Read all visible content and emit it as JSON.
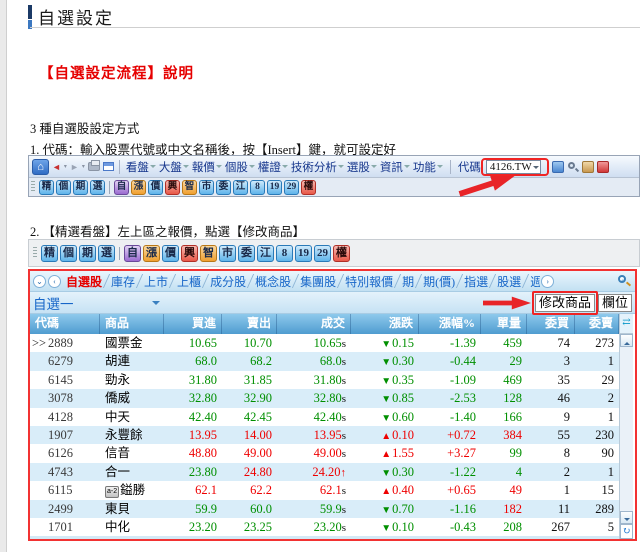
{
  "doc": {
    "title": "自選設定",
    "heading": "【自選設定流程】說明",
    "methods_line": "3 種自選股設定方式",
    "step1": "1. 代碼：輸入股票代號或中文名稱後，按【Insert】鍵，就可設定好",
    "step2": "2. 【精選看盤】左上區之報價，點選【修改商品】"
  },
  "browser_toolbar": {
    "menus": [
      "看盤",
      "大盤",
      "報價",
      "個股",
      "權證",
      "技術分析",
      "選股",
      "資訊",
      "功能"
    ],
    "code_label": "代碼",
    "code_value": "4126.TW"
  },
  "icon_strip": {
    "buttons": [
      {
        "label": "精",
        "color": "blue"
      },
      {
        "label": "個",
        "color": "blue"
      },
      {
        "label": "期",
        "color": "blue"
      },
      {
        "label": "選",
        "color": "blue"
      },
      {
        "label": "自",
        "color": "purple"
      },
      {
        "label": "漲",
        "color": "orange"
      },
      {
        "label": "價",
        "color": "blue"
      },
      {
        "label": "興",
        "color": "red"
      },
      {
        "label": "智",
        "color": "orange"
      },
      {
        "label": "市",
        "color": "blue"
      },
      {
        "label": "委",
        "color": "blue"
      },
      {
        "label": "江",
        "color": "blue"
      },
      {
        "label": "8",
        "color": "blue"
      },
      {
        "label": "19",
        "color": "blue"
      },
      {
        "label": "29",
        "color": "blue"
      },
      {
        "label": "權",
        "color": "red"
      }
    ],
    "divider_after_index": 3
  },
  "quote_panel": {
    "tabs": [
      {
        "label": "自選股",
        "active": true
      },
      {
        "label": "庫存"
      },
      {
        "label": "上市"
      },
      {
        "label": "上櫃"
      },
      {
        "label": "成分股"
      },
      {
        "label": "概念股"
      },
      {
        "label": "集團股"
      },
      {
        "label": "特別報價"
      },
      {
        "label": "期"
      },
      {
        "label": "期(價)"
      },
      {
        "label": "指選"
      },
      {
        "label": "股選"
      },
      {
        "label": "週",
        "clipped": true
      }
    ],
    "watchlist_name": "自選一",
    "modify_button_label": "修改商品",
    "columns_button_label": "欄位",
    "table": {
      "columns": [
        "代碼",
        "商品",
        "買進",
        "賣出",
        "成交",
        "漲跌",
        "漲幅%",
        "單量",
        "委買",
        "委賣"
      ],
      "rows": [
        {
          "prefix": ">>",
          "code": "2889",
          "name": "國票金",
          "buy": "10.65",
          "sell": "10.70",
          "last": "10.65",
          "sfx": "s",
          "sfx_c": "k",
          "dir": "down",
          "chg": "0.15",
          "pct": "-1.39",
          "vol": "459",
          "vol_c": "g",
          "bid": "74",
          "ask": "273",
          "pc": "ggg"
        },
        {
          "prefix": "",
          "code": "6279",
          "name": "胡連",
          "buy": "68.0",
          "sell": "68.2",
          "last": "68.0",
          "sfx": "s",
          "sfx_c": "k",
          "dir": "down",
          "chg": "0.30",
          "pct": "-0.44",
          "vol": "29",
          "vol_c": "g",
          "bid": "3",
          "ask": "1",
          "pc": "ggg"
        },
        {
          "prefix": "",
          "code": "6145",
          "name": "勁永",
          "buy": "31.80",
          "sell": "31.85",
          "last": "31.80",
          "sfx": "s",
          "sfx_c": "k",
          "dir": "down",
          "chg": "0.35",
          "pct": "-1.09",
          "vol": "469",
          "vol_c": "g",
          "bid": "35",
          "ask": "29",
          "pc": "ggg"
        },
        {
          "prefix": "",
          "code": "3078",
          "name": "僑威",
          "buy": "32.80",
          "sell": "32.90",
          "last": "32.80",
          "sfx": "s",
          "sfx_c": "k",
          "dir": "down",
          "chg": "0.85",
          "pct": "-2.53",
          "vol": "128",
          "vol_c": "g",
          "bid": "46",
          "ask": "2",
          "pc": "ggg"
        },
        {
          "prefix": "",
          "code": "4128",
          "name": "中天",
          "buy": "42.40",
          "sell": "42.45",
          "last": "42.40",
          "sfx": "s",
          "sfx_c": "k",
          "dir": "down",
          "chg": "0.60",
          "pct": "-1.40",
          "vol": "166",
          "vol_c": "g",
          "bid": "9",
          "ask": "1",
          "pc": "ggg"
        },
        {
          "prefix": "",
          "code": "1907",
          "name": "永豐餘",
          "buy": "13.95",
          "sell": "14.00",
          "last": "13.95",
          "sfx": "s",
          "sfx_c": "k",
          "dir": "up",
          "chg": "0.10",
          "pct": "+0.72",
          "vol": "384",
          "vol_c": "r",
          "bid": "55",
          "ask": "230",
          "pc": "rrr"
        },
        {
          "prefix": "",
          "code": "6126",
          "name": "信音",
          "buy": "48.80",
          "sell": "49.00",
          "last": "49.00",
          "sfx": "s",
          "sfx_c": "k",
          "dir": "up",
          "chg": "1.55",
          "pct": "+3.27",
          "vol": "99",
          "vol_c": "g",
          "bid": "8",
          "ask": "90",
          "pc": "rrr"
        },
        {
          "prefix": "",
          "code": "4743",
          "name": "合一",
          "buy": "23.80",
          "sell": "24.80",
          "last": "24.20",
          "sfx": "↑",
          "sfx_c": "r",
          "dir": "down",
          "chg": "0.30",
          "pct": "-1.22",
          "vol": "4",
          "vol_c": "g",
          "bid": "2",
          "ask": "1",
          "pc": "grr"
        },
        {
          "prefix": "",
          "code": "6115",
          "name": "鎰勝",
          "badge": "a-2",
          "buy": "62.1",
          "sell": "62.2",
          "last": "62.1",
          "sfx": "s",
          "sfx_c": "k",
          "dir": "up",
          "chg": "0.40",
          "pct": "+0.65",
          "vol": "49",
          "vol_c": "r",
          "bid": "1",
          "ask": "15",
          "pc": "rrr"
        },
        {
          "prefix": "",
          "code": "2499",
          "name": "東貝",
          "buy": "59.9",
          "sell": "60.0",
          "last": "59.9",
          "sfx": "s",
          "sfx_c": "k",
          "dir": "down",
          "chg": "0.70",
          "pct": "-1.16",
          "vol": "182",
          "vol_c": "r",
          "bid": "11",
          "ask": "289",
          "pc": "ggg"
        },
        {
          "prefix": "",
          "code": "1701",
          "name": "中化",
          "buy": "23.20",
          "sell": "23.25",
          "last": "23.20",
          "sfx": "s",
          "sfx_c": "k",
          "dir": "down",
          "chg": "0.10",
          "pct": "-0.43",
          "vol": "208",
          "vol_c": "g",
          "bid": "267",
          "ask": "5",
          "pc": "ggg"
        }
      ]
    }
  },
  "colors": {
    "up": "#ee0000",
    "down": "#008f00",
    "neutral": "#101010",
    "annotation": "#f02424",
    "tab_active": "#e60000",
    "tab_link": "#1766c8"
  }
}
